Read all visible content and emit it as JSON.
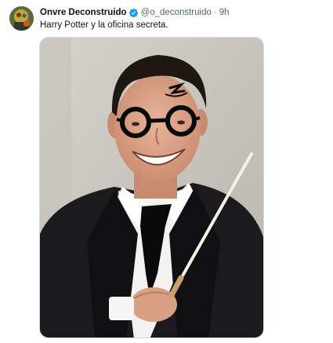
{
  "post": {
    "author_name": "Onvre Deconstruido",
    "verified_icon": "verified-badge-icon",
    "handle": "@o_deconstruido",
    "separator": "·",
    "timestamp": "9h",
    "text": "Harry Potter y la oficina secreta."
  },
  "colors": {
    "verified": "#1d9bf0",
    "text_primary": "#0f1419",
    "text_secondary": "#536471"
  }
}
